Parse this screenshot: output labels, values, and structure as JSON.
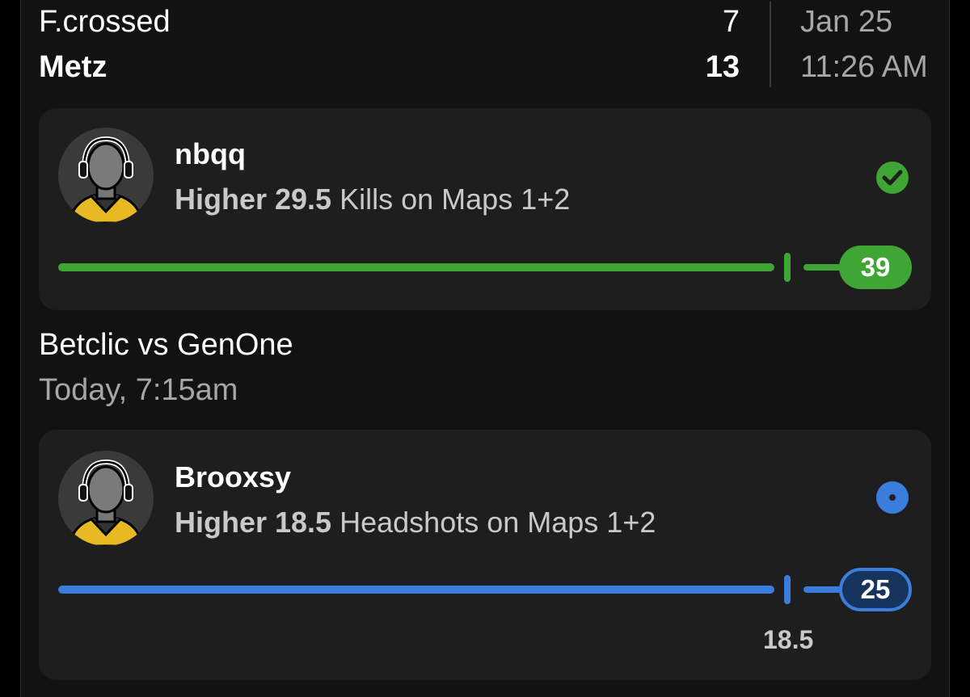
{
  "game": {
    "team1": {
      "name": "F.crossed",
      "score": "7"
    },
    "team2": {
      "name": "Metz",
      "score": "13"
    },
    "date": "Jan 25",
    "time": "11:26 AM"
  },
  "picks": [
    {
      "player": "nbqq",
      "direction": "Higher 29.5",
      "stat": "Kills on Maps 1+2",
      "line": 29.5,
      "actual": "39",
      "status": "won",
      "status_icon": "check-circle-icon",
      "color": "#3fa535"
    },
    {
      "player": "Brooxsy",
      "direction": "Higher 18.5",
      "stat": "Headshots on Maps 1+2",
      "line": 18.5,
      "line_label": "18.5",
      "actual": "25",
      "status": "live",
      "status_icon": "live-dot-icon",
      "color": "#3b7ddd"
    }
  ],
  "match": {
    "title": "Betclic vs GenOne",
    "time": "Today, 7:15am"
  }
}
